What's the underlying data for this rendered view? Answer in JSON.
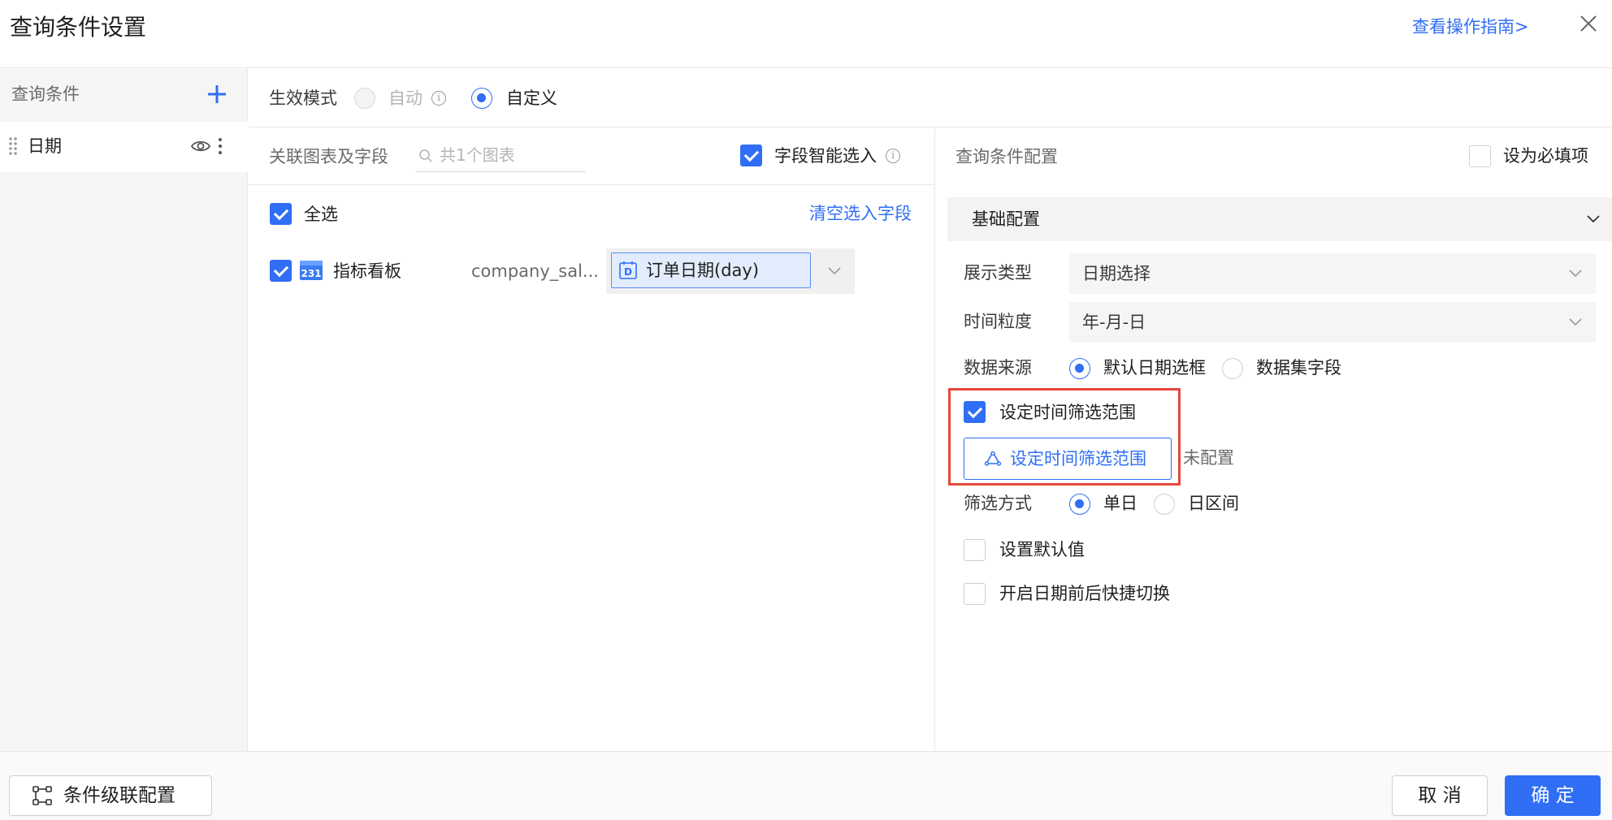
{
  "header": {
    "title": "查询条件设置",
    "guide_link": "查看操作指南>"
  },
  "left_panel": {
    "title": "查询条件",
    "conditions": [
      {
        "label": "日期"
      }
    ]
  },
  "mode": {
    "label": "生效模式",
    "options": [
      {
        "label": "自动",
        "state": "disabled"
      },
      {
        "label": "自定义",
        "state": "checked"
      }
    ]
  },
  "middle": {
    "header_label": "关联图表及字段",
    "search_placeholder": "共1个图表",
    "smart_select_label": "字段智能选入",
    "smart_select_checked": true,
    "select_all_label": "全选",
    "clear_link": "清空选入字段",
    "rows": [
      {
        "checked": true,
        "icon": "calendar-231-icon",
        "chart_name": "指标看板",
        "dataset": "company_sal...",
        "field": "订单日期(day)"
      }
    ]
  },
  "right": {
    "header_label": "查询条件配置",
    "required_label": "设为必填项",
    "section_title": "基础配置",
    "display_type": {
      "label": "展示类型",
      "value": "日期选择"
    },
    "granularity": {
      "label": "时间粒度",
      "value": "年-月-日"
    },
    "data_source": {
      "label": "数据来源",
      "options": [
        "默认日期选框",
        "数据集字段"
      ],
      "selected": "默认日期选框"
    },
    "time_range_checkbox": {
      "label": "设定时间筛选范围",
      "checked": true
    },
    "time_range_button": "设定时间筛选范围",
    "time_range_status": "未配置",
    "filter_method": {
      "label": "筛选方式",
      "options": [
        "单日",
        "日区间"
      ],
      "selected": "单日"
    },
    "default_value_label": "设置默认值",
    "quick_switch_label": "开启日期前后快捷切换"
  },
  "footer": {
    "cascade_button": "条件级联配置",
    "cancel_button": "取 消",
    "ok_button": "确 定"
  },
  "colors": {
    "accent": "#2f6ef5",
    "highlight": "#e8453c"
  }
}
